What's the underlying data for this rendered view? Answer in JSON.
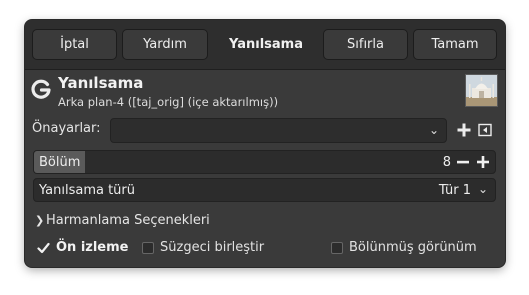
{
  "header": {
    "cancel_label": "İptal",
    "help_label": "Yardım",
    "title": "Yanılsama",
    "reset_label": "Sıfırla",
    "ok_label": "Tamam"
  },
  "operation": {
    "icon": "gimp-g-icon",
    "title": "Yanılsama",
    "subtitle": "Arka plan-4 ([taj_orig] (içe aktarılmış))"
  },
  "presets": {
    "label": "Önayarlar:",
    "value": ""
  },
  "divisions": {
    "label": "Bölüm",
    "value": "8",
    "fill_fraction": 0.11
  },
  "illusion_type": {
    "label": "Yanılsama türü",
    "value": "Tür 1"
  },
  "blending": {
    "label": "Harmanlama Seçenekleri"
  },
  "options": {
    "preview_label": "Ön izleme",
    "preview_checked": true,
    "merge_filter_label": "Süzgeci birleştir",
    "merge_filter_checked": false,
    "split_view_label": "Bölünmüş görünüm",
    "split_view_checked": false
  },
  "colors": {
    "dialog_bg": "#3a3a3a",
    "header_bg": "#2e2e2e",
    "field_bg": "#2c2c2c",
    "text": "#e8e8e8"
  }
}
